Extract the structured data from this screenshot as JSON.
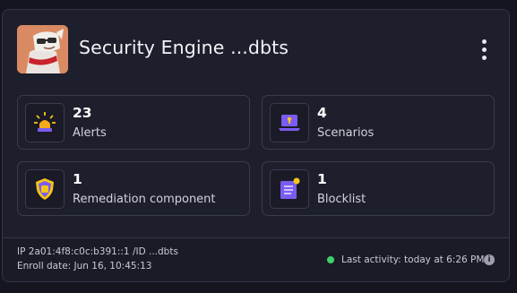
{
  "engine": {
    "title": "Security Engine ...dbts"
  },
  "stats": [
    {
      "value": "23",
      "label": "Alerts",
      "icon": "alarm-light-icon"
    },
    {
      "value": "4",
      "label": "Scenarios",
      "icon": "laptop-lock-icon"
    },
    {
      "value": "1",
      "label": "Remediation component",
      "icon": "shield-fist-icon"
    },
    {
      "value": "1",
      "label": "Blocklist",
      "icon": "document-list-icon"
    }
  ],
  "footer": {
    "ip": "IP 2a01:4f8:c0c:b391::1 /ID ...dbts",
    "enroll": "Enroll date: Jun 16, 10:45:13",
    "activity": "Last activity: today at 6:26 PM",
    "status_color": "#3ecf6e"
  },
  "colors": {
    "background": "#14151f",
    "card": "#1e1f2c",
    "border": "#3a3c4f",
    "accent_purple": "#7b5cf0",
    "accent_yellow": "#f5c518"
  }
}
